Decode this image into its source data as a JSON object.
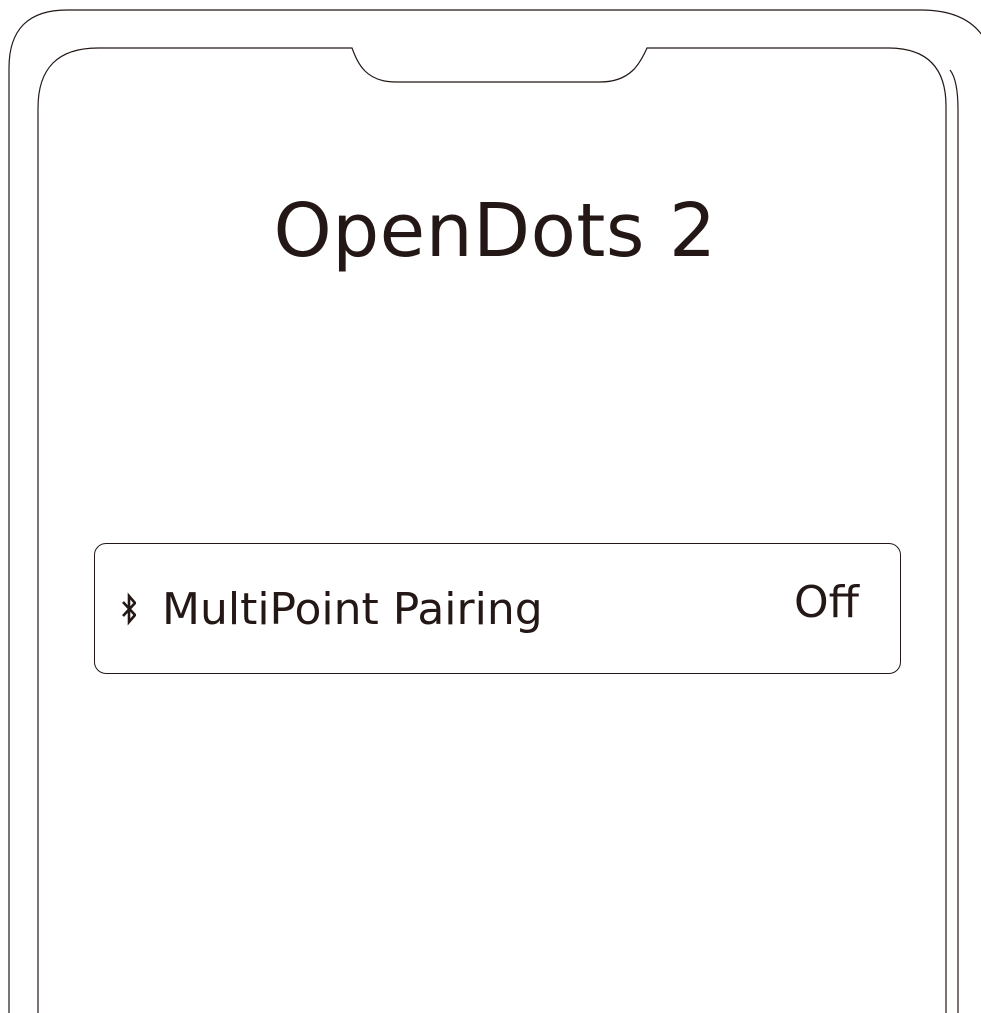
{
  "device": {
    "name": "OpenDots 2"
  },
  "settings": {
    "multipoint": {
      "icon": "bluetooth-icon",
      "label": "MultiPoint Pairing",
      "value": "Off"
    }
  },
  "colors": {
    "ink": "#231815",
    "background": "#ffffff"
  }
}
